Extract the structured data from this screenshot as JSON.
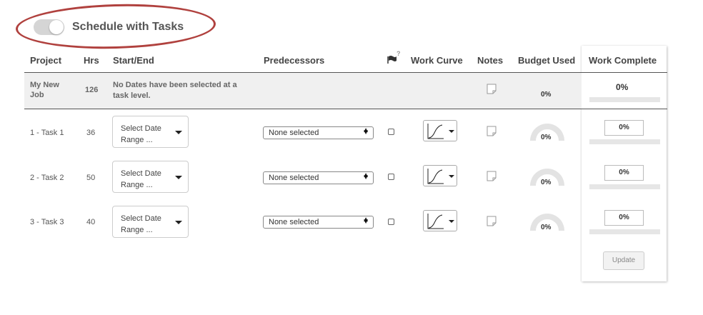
{
  "toggle": {
    "label": "Schedule with Tasks",
    "on": false
  },
  "headers": {
    "project": "Project",
    "hrs": "Hrs",
    "start_end": "Start/End",
    "predecessors": "Predecessors",
    "milestone_icon": "flag-icon",
    "milestone_help": "?",
    "work_curve": "Work Curve",
    "notes": "Notes",
    "budget_used": "Budget Used",
    "work_complete": "Work Complete"
  },
  "job": {
    "name": "My New Job",
    "hrs": "126",
    "dates_text": "No Dates have been selected at a task level.",
    "budget_used": "0%",
    "work_complete": "0%"
  },
  "tasks": [
    {
      "name": "1 - Task 1",
      "hrs": "36",
      "date_label": "Select Date Range ...",
      "predecessors": "None selected",
      "budget_used": "0%",
      "work_complete": "0%"
    },
    {
      "name": "2 - Task 2",
      "hrs": "50",
      "date_label": "Select Date Range ...",
      "predecessors": "None selected",
      "budget_used": "0%",
      "work_complete": "0%"
    },
    {
      "name": "3 - Task 3",
      "hrs": "40",
      "date_label": "Select Date Range ...",
      "predecessors": "None selected",
      "budget_used": "0%",
      "work_complete": "0%"
    }
  ],
  "update_label": "Update",
  "colors": {
    "highlight": "#b0413e",
    "divider": "#555555",
    "job_bg": "#f0f0f0"
  }
}
